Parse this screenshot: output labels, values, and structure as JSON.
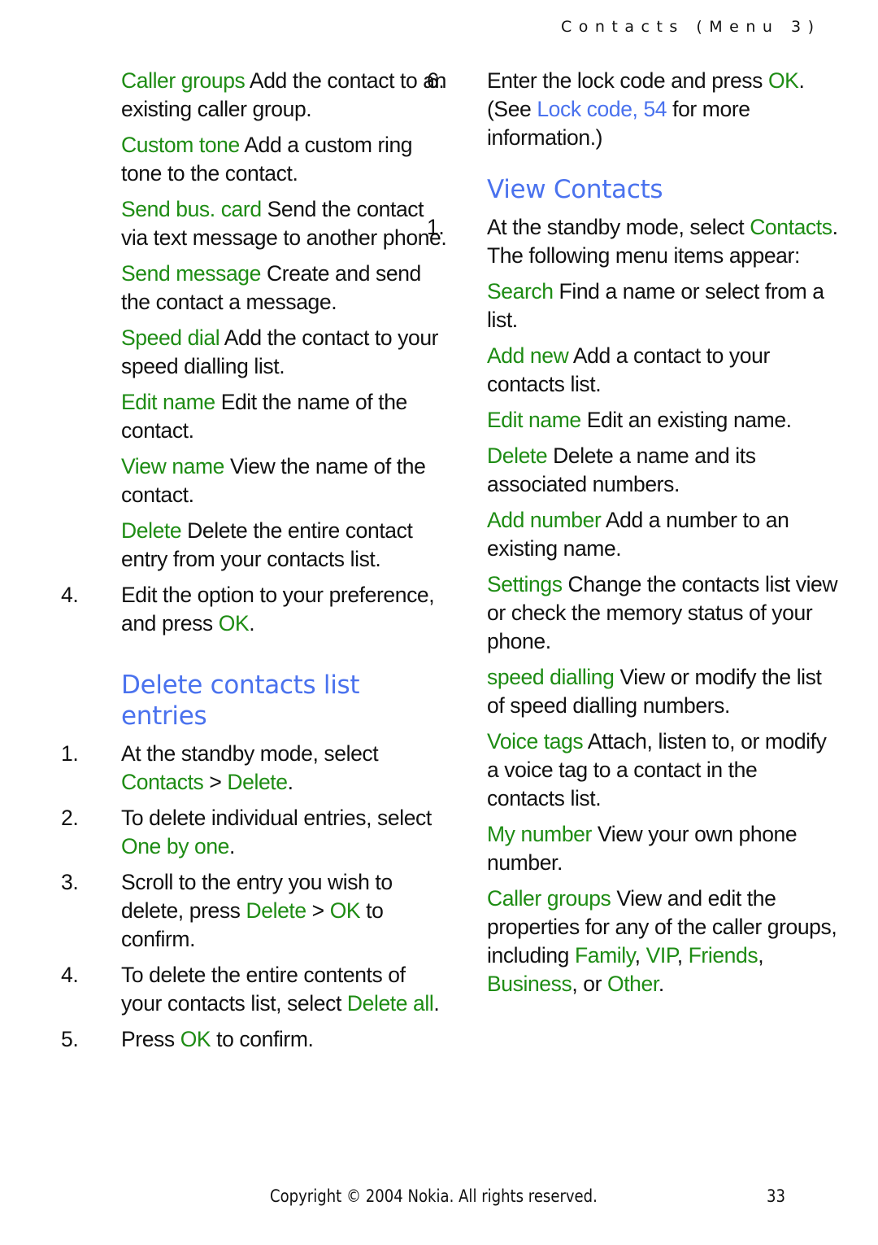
{
  "header": {
    "running_head": "Contacts (Menu 3)"
  },
  "left_column": {
    "options": [
      {
        "term": "Caller groups",
        "desc": "Add the contact to an existing caller group."
      },
      {
        "term": "Custom tone",
        "desc": "Add a custom ring tone to the contact."
      },
      {
        "term": "Send bus. card",
        "desc": "Send the contact via text message to another phone."
      },
      {
        "term": "Send message",
        "desc": "Create and send the contact a message."
      },
      {
        "term": "Speed dial",
        "desc": "Add the contact to your speed dialling list."
      },
      {
        "term": "Edit name",
        "desc": "Edit the name of the contact."
      },
      {
        "term": "View name",
        "desc": "View the name of the contact."
      },
      {
        "term": "Delete",
        "desc": "Delete the entire contact entry from your contacts list."
      }
    ],
    "step4": {
      "num": "4.",
      "text": "Edit the option to your preference, and press ",
      "key": "OK",
      "end": "."
    },
    "delete_section": {
      "heading_line1": "Delete contacts list",
      "heading_line2": "entries",
      "steps": [
        {
          "num": "1.",
          "text": "At the standby mode, select ",
          "k1": "Contacts",
          "sep": " > ",
          "k2": "Delete",
          "end": "."
        },
        {
          "num": "2.",
          "text": "To delete individual entries, select ",
          "k1": "One by one",
          "end": "."
        },
        {
          "num": "3.",
          "text": "Scroll to the entry you wish to delete, press ",
          "k1": "Delete",
          "sep": " > ",
          "k2": "OK",
          "end": " to confirm."
        },
        {
          "num": "4.",
          "text": "To delete the entire contents of your contacts list, select ",
          "k1": "Delete all",
          "end": "."
        },
        {
          "num": "5.",
          "text": "Press ",
          "k1": "OK",
          "end": " to confirm."
        }
      ]
    }
  },
  "right_column": {
    "step6": {
      "num": "6.",
      "text": "Enter the lock code and press ",
      "key": "OK",
      "end": ".",
      "see_pre": "(See ",
      "link": "Lock code, 54",
      "see_post": " for more information.)"
    },
    "view_section": {
      "heading": "View Contacts",
      "step1": {
        "num": "1.",
        "text": "At the standby mode, select ",
        "key": "Contacts",
        "end": ". The following menu items appear:"
      },
      "items": [
        {
          "term": "Search",
          "desc": "Find a name or select from a list."
        },
        {
          "term": "Add new",
          "desc": "Add a contact to your contacts list."
        },
        {
          "term": "Edit name",
          "desc": "Edit an existing name."
        },
        {
          "term": "Delete",
          "desc": "Delete a name and its associated numbers."
        },
        {
          "term": "Add number",
          "desc": "Add a number to an existing name."
        },
        {
          "term": "Settings",
          "desc": "Change the contacts list view or check the memory status of your phone."
        },
        {
          "term": "speed dialling",
          "desc": "View or modify the list of speed dialling numbers."
        },
        {
          "term": "Voice tags",
          "desc": "Attach, listen to, or modify a voice tag to a contact in the contacts list."
        },
        {
          "term": "My number",
          "desc": "View your own phone number."
        }
      ],
      "caller_groups": {
        "term": "Caller groups",
        "desc": "View and edit the properties for any of the caller groups, including ",
        "g1": "Family",
        "g2": "VIP",
        "g3": "Friends",
        "g4": "Business",
        "or": " or ",
        "g5": "Other",
        "end": "."
      }
    }
  },
  "footer": {
    "copyright": "Copyright © 2004 Nokia. All rights reserved.",
    "page_number": "33"
  }
}
